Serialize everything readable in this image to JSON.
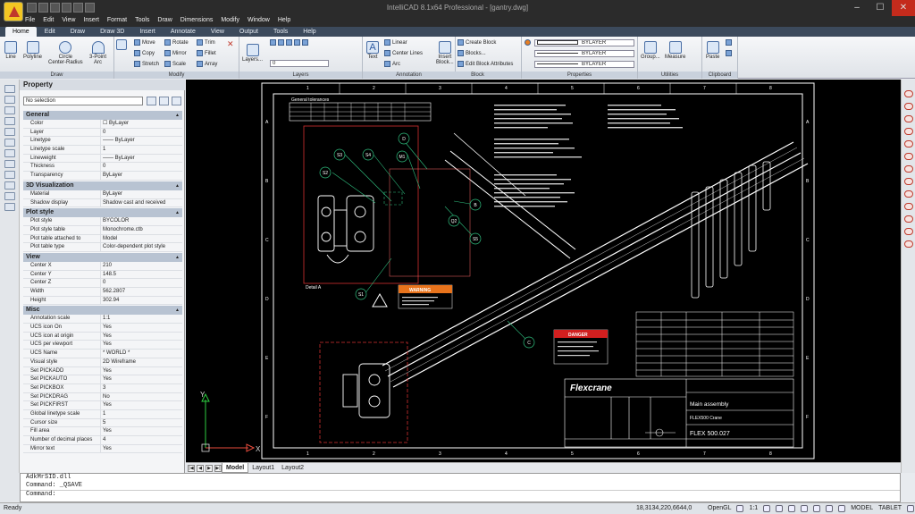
{
  "titlebar": {
    "title": "IntelliCAD 8.1x64 Professional - [gantry.dwg]",
    "min": "–",
    "max": "☐",
    "close": "✕"
  },
  "menu": [
    "File",
    "Edit",
    "View",
    "Insert",
    "Format",
    "Tools",
    "Draw",
    "Dimensions",
    "Modify",
    "Window",
    "Help"
  ],
  "ribbon_tabs": [
    "Home",
    "Edit",
    "Draw",
    "Draw 3D",
    "Insert",
    "Annotate",
    "View",
    "Output",
    "Tools",
    "Help"
  ],
  "ribbon": {
    "draw": {
      "label": "Draw",
      "line": "Line",
      "polyline": "Polyline",
      "circle": "Circle",
      "circle_sub": "Center-Radius",
      "arc": "3-Point",
      "arc_sub": "Arc"
    },
    "modify": {
      "label": "Modify",
      "move": "Move",
      "rotate": "Rotate",
      "trim": "Trim",
      "copy": "Copy",
      "mirror": "Mirror",
      "fillet": "Fillet",
      "stretch": "Stretch",
      "scale": "Scale",
      "array": "Array"
    },
    "layers": {
      "label": "Layers",
      "layers_btn": "Layers...",
      "layer_value": "0"
    },
    "annotation": {
      "label": "Annotation",
      "text": "Text",
      "linear": "Linear",
      "centerlines": "Center Lines",
      "arc": "Arc"
    },
    "block": {
      "label": "Block",
      "insert": "Insert",
      "insert_sub": "Block...",
      "create": "Create Block",
      "blocks": "Blocks...",
      "edit_attr": "Edit Block Attributes"
    },
    "properties": {
      "label": "Properties",
      "color": "BYLAYER",
      "linetype": "BYLAYER",
      "lineweight": "BYLAYER"
    },
    "utilities": {
      "label": "Utilities",
      "group": "Group...",
      "measure": "Measure"
    },
    "clipboard": {
      "label": "Clipboard",
      "paste": "Paste"
    }
  },
  "props": {
    "title": "Property",
    "selection": "No selection",
    "sections": [
      {
        "name": "General",
        "rows": [
          [
            "Color",
            "☐ ByLayer"
          ],
          [
            "Layer",
            "0"
          ],
          [
            "Linetype",
            "—— ByLayer"
          ],
          [
            "Linetype scale",
            "1"
          ],
          [
            "Lineweight",
            "—— ByLayer"
          ],
          [
            "Thickness",
            "0"
          ],
          [
            "Transparency",
            "ByLayer"
          ]
        ]
      },
      {
        "name": "3D Visualization",
        "rows": [
          [
            "Material",
            "ByLayer"
          ],
          [
            "Shadow display",
            "Shadow cast and received"
          ]
        ]
      },
      {
        "name": "Plot style",
        "rows": [
          [
            "Plot style",
            "BYCOLOR"
          ],
          [
            "Plot style table",
            "Monochrome.ctb"
          ],
          [
            "Plot table attached to",
            "Model"
          ],
          [
            "Plot table type",
            "Color-dependent plot style"
          ]
        ]
      },
      {
        "name": "View",
        "rows": [
          [
            "Center X",
            "210"
          ],
          [
            "Center Y",
            "148.5"
          ],
          [
            "Center Z",
            "0"
          ],
          [
            "Width",
            "562.2807"
          ],
          [
            "Height",
            "302.94"
          ]
        ]
      },
      {
        "name": "Misc",
        "rows": [
          [
            "Annotation scale",
            "1:1"
          ],
          [
            "UCS icon On",
            "Yes"
          ],
          [
            "UCS icon at origin",
            "Yes"
          ],
          [
            "UCS per viewport",
            "Yes"
          ],
          [
            "UCS Name",
            "* WORLD *"
          ],
          [
            "Visual style",
            "2D Wireframe"
          ],
          [
            "Set PICKADD",
            "Yes"
          ],
          [
            "Set PICKAUTO",
            "Yes"
          ],
          [
            "Set PICKBOX",
            "3"
          ],
          [
            "Set PICKDRAG",
            "No"
          ],
          [
            "Set PICKFIRST",
            "Yes"
          ],
          [
            "Global linetype scale",
            "1"
          ],
          [
            "Cursor size",
            "5"
          ],
          [
            "Fill area",
            "Yes"
          ],
          [
            "Number of decimal places",
            "4"
          ],
          [
            "Mirror text",
            "Yes"
          ]
        ]
      }
    ]
  },
  "drawing": {
    "grid_cols": [
      "1",
      "2",
      "3",
      "4",
      "5",
      "6",
      "7",
      "8"
    ],
    "grid_rows": [
      "A",
      "B",
      "C",
      "D",
      "E",
      "F"
    ],
    "tolerance_title": "General tolerances",
    "detail_label": "Detail A",
    "warning": "WARNING",
    "danger": "DANGER",
    "brand": "Flexcrane",
    "title_block": {
      "name": "Main assembly",
      "sub": "FLEX500 Crane",
      "number": "FLEX 500.027"
    },
    "balloons": [
      "S3",
      "S4",
      "M1",
      "S2",
      "S1",
      "S5",
      "D",
      "B",
      "Q2",
      "C"
    ],
    "ucs_x": "X",
    "ucs_y": "Y"
  },
  "layout_tabs": [
    "Model",
    "Layout1",
    "Layout2"
  ],
  "command": {
    "lines": [
      "AdkMrSID.dll",
      "Command: _QSAVE"
    ],
    "prompt": "Command:"
  },
  "status": {
    "ready": "Ready",
    "coords": "18,3134,220,6644,0",
    "renderer": "OpenGL",
    "scale": "1:1",
    "model": "MODEL",
    "tablet": "TABLET"
  }
}
